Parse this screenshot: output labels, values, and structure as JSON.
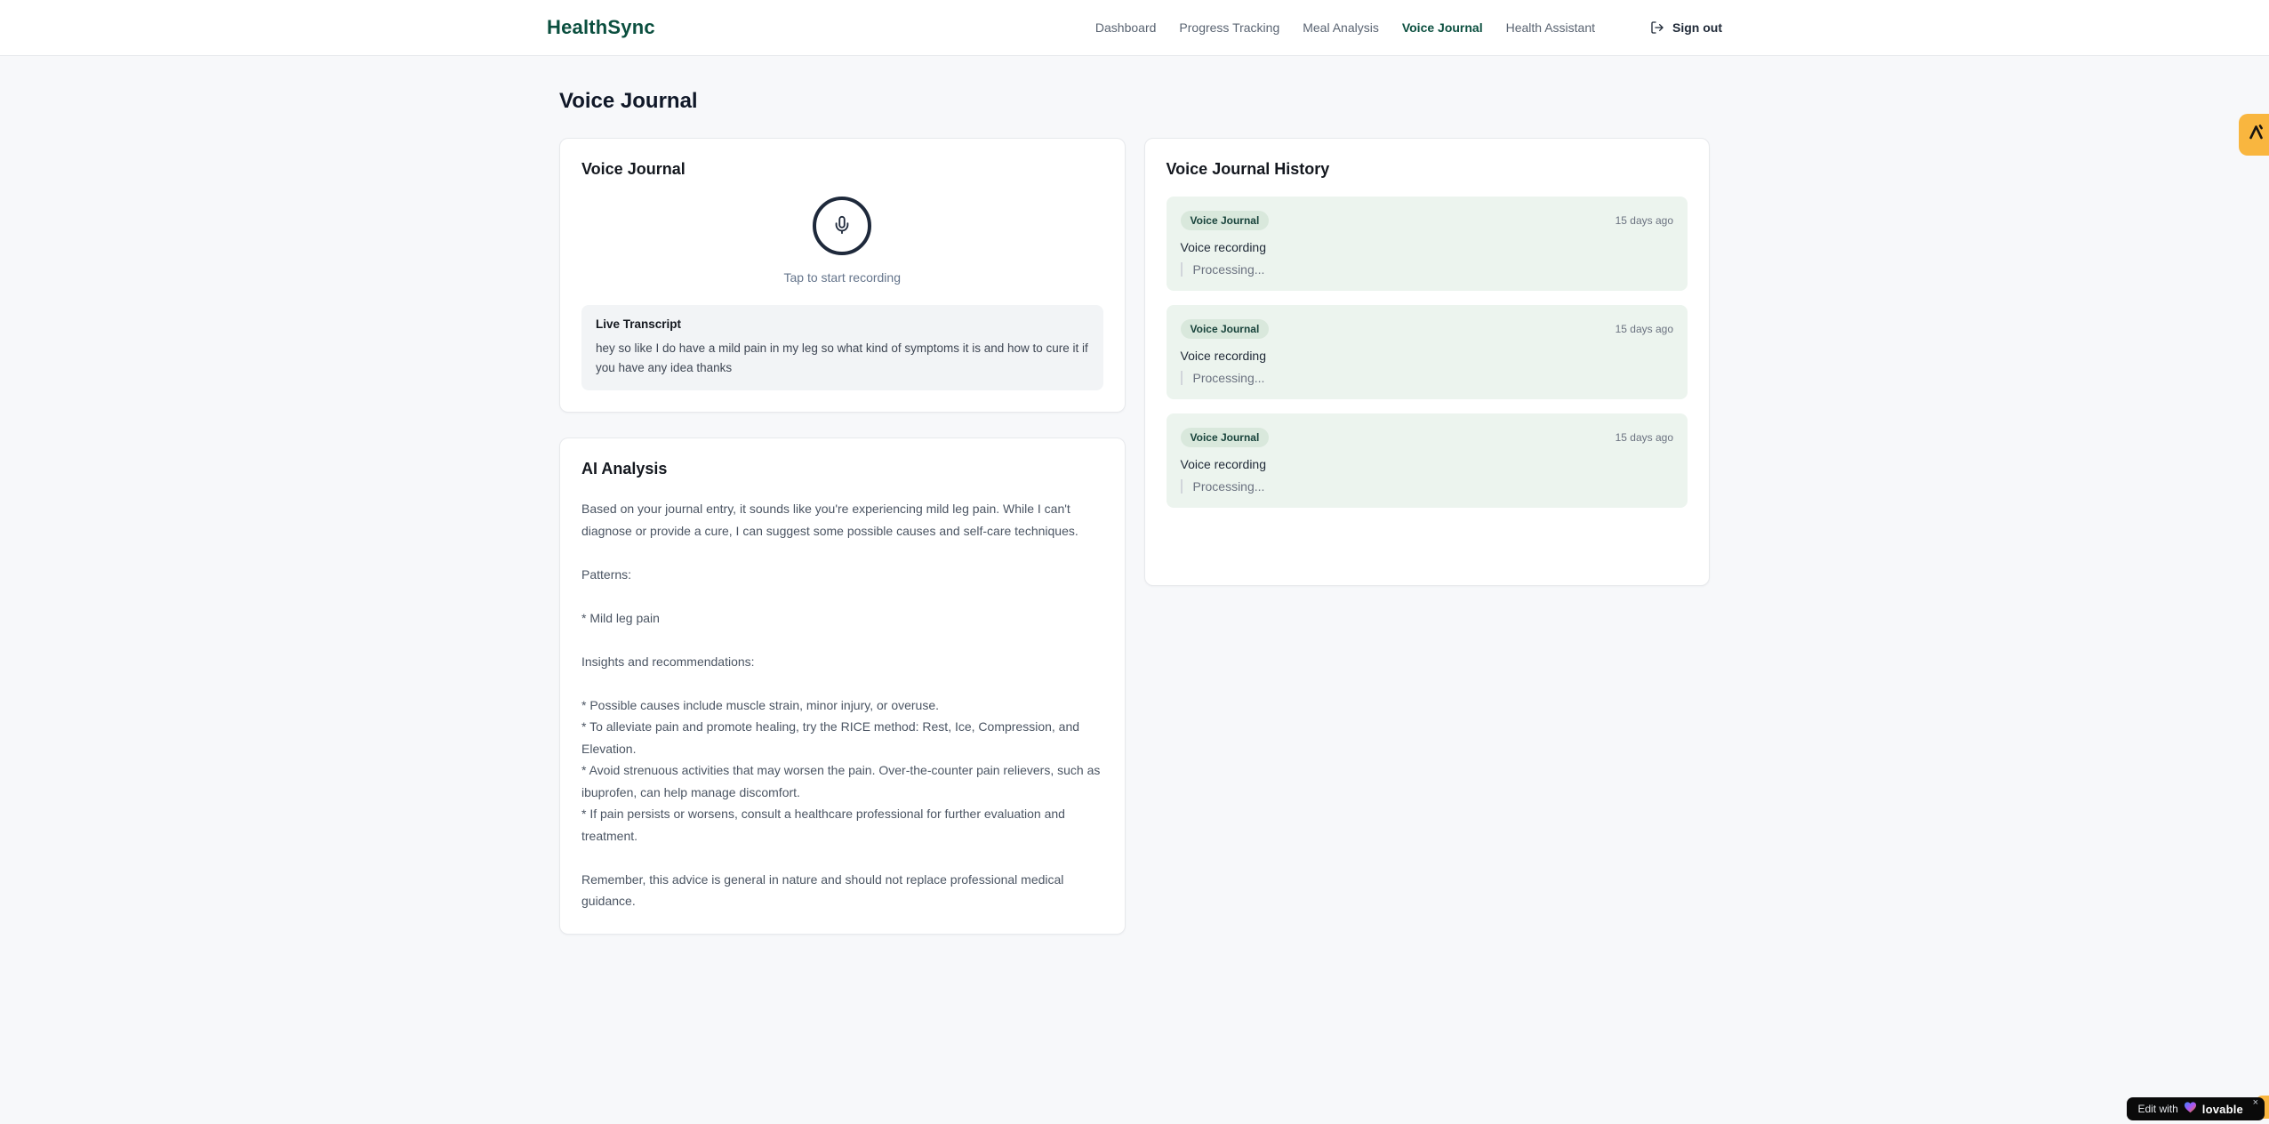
{
  "brand": "HealthSync",
  "nav": {
    "items": [
      {
        "label": "Dashboard",
        "active": false
      },
      {
        "label": "Progress Tracking",
        "active": false
      },
      {
        "label": "Meal Analysis",
        "active": false
      },
      {
        "label": "Voice Journal",
        "active": true
      },
      {
        "label": "Health Assistant",
        "active": false
      }
    ],
    "sign_out_label": "Sign out"
  },
  "page": {
    "title": "Voice Journal"
  },
  "recorder": {
    "card_title": "Voice Journal",
    "tap_hint": "Tap to start recording",
    "transcript_title": "Live Transcript",
    "transcript_text": "hey so like I do have a mild pain in my leg so what kind of symptoms it is and how to cure it if you have any idea thanks"
  },
  "analysis": {
    "card_title": "AI Analysis",
    "body": "Based on your journal entry, it sounds like you're experiencing mild leg pain. While I can't diagnose or provide a cure, I can suggest some possible causes and self-care techniques.\n\nPatterns:\n\n* Mild leg pain\n\nInsights and recommendations:\n\n* Possible causes include muscle strain, minor injury, or overuse.\n* To alleviate pain and promote healing, try the RICE method: Rest, Ice, Compression, and Elevation.\n* Avoid strenuous activities that may worsen the pain. Over-the-counter pain relievers, such as ibuprofen, can help manage discomfort.\n* If pain persists or worsens, consult a healthcare professional for further evaluation and treatment.\n\nRemember, this advice is general in nature and should not replace professional medical guidance."
  },
  "history": {
    "card_title": "Voice Journal History",
    "entries": [
      {
        "badge": "Voice Journal",
        "time": "15 days ago",
        "title": "Voice recording",
        "status": "Processing..."
      },
      {
        "badge": "Voice Journal",
        "time": "15 days ago",
        "title": "Voice recording",
        "status": "Processing..."
      },
      {
        "badge": "Voice Journal",
        "time": "15 days ago",
        "title": "Voice recording",
        "status": "Processing..."
      }
    ]
  },
  "edit_badge": {
    "prefix": "Edit with",
    "brand": "lovable",
    "close": "×"
  },
  "colors": {
    "brand_green": "#0b4f3f",
    "page_background": "#f7f8fa",
    "card_border": "#e7e9ec",
    "entry_background": "#ecf4ee",
    "badge_background": "#d9e8dc",
    "badge_text": "#18433b",
    "mic_ring": "#1e293b",
    "muted_text": "#6b7280",
    "amber_tab": "#f9b63f",
    "edit_badge_background": "#0a0a0a"
  }
}
